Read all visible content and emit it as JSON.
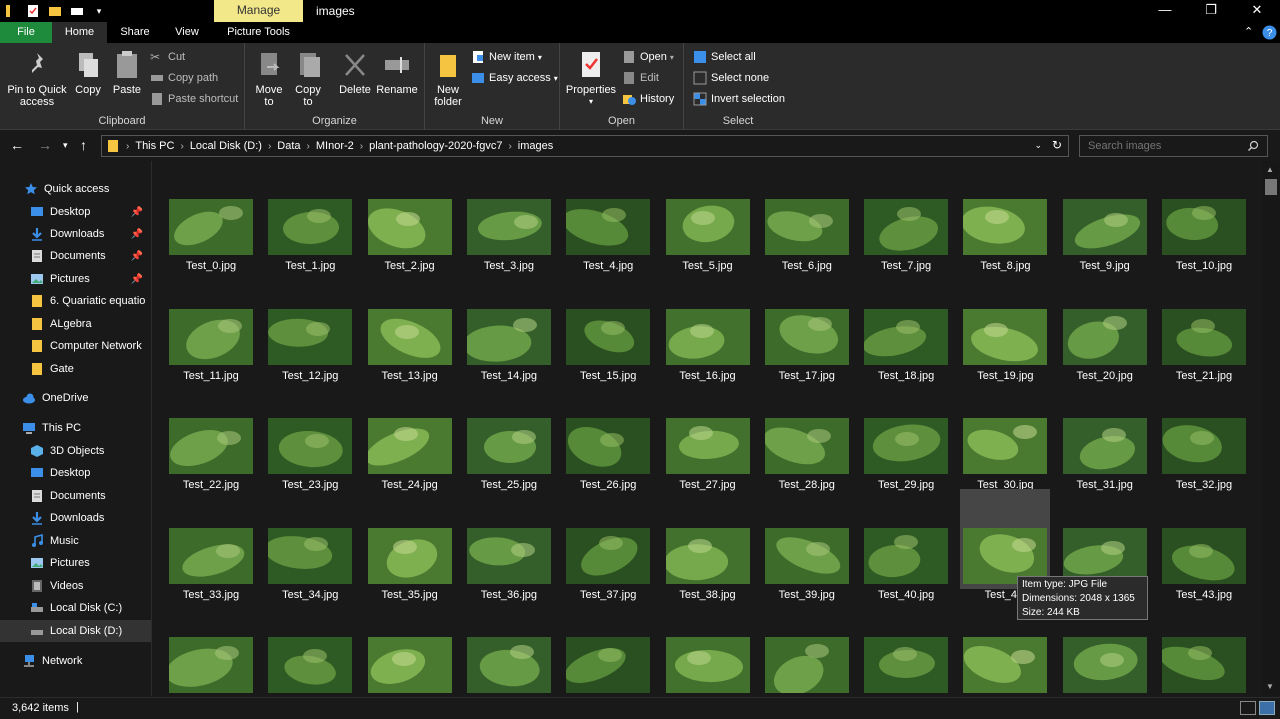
{
  "window": {
    "title": "images",
    "manage_tab": "Manage",
    "controls": {
      "minimize": "—",
      "maximize": "❐",
      "close": "✕"
    }
  },
  "ribbon_tabs": {
    "file": "File",
    "home": "Home",
    "share": "Share",
    "view": "View",
    "picture_tools": "Picture Tools"
  },
  "ribbon": {
    "clipboard": {
      "label": "Clipboard",
      "pin": "Pin to Quick access",
      "copy": "Copy",
      "paste": "Paste",
      "cut": "Cut",
      "copy_path": "Copy path",
      "paste_shortcut": "Paste shortcut"
    },
    "organize": {
      "label": "Organize",
      "move_to": "Move to",
      "copy_to": "Copy to",
      "delete": "Delete",
      "rename": "Rename"
    },
    "new": {
      "label": "New",
      "new_folder": "New folder",
      "new_item": "New item",
      "easy_access": "Easy access"
    },
    "open": {
      "label": "Open",
      "properties": "Properties",
      "open": "Open",
      "edit": "Edit",
      "history": "History"
    },
    "select": {
      "label": "Select",
      "select_all": "Select all",
      "select_none": "Select none",
      "invert": "Invert selection"
    }
  },
  "address": {
    "crumbs": [
      "This PC",
      "Local Disk (D:)",
      "Data",
      "MInor-2",
      "plant-pathology-2020-fgvc7",
      "images"
    ],
    "search_placeholder": "Search images"
  },
  "sidebar": {
    "quick_access": "Quick access",
    "qa_items": [
      "Desktop",
      "Downloads",
      "Documents",
      "Pictures",
      "6. Quariatic equatio",
      "ALgebra",
      "Computer Network",
      "Gate"
    ],
    "onedrive": "OneDrive",
    "this_pc": "This PC",
    "pc_items": [
      "3D Objects",
      "Desktop",
      "Documents",
      "Downloads",
      "Music",
      "Pictures",
      "Videos",
      "Local Disk (C:)",
      "Local Disk (D:)"
    ],
    "network": "Network"
  },
  "files": [
    "Test_0.jpg",
    "Test_1.jpg",
    "Test_2.jpg",
    "Test_3.jpg",
    "Test_4.jpg",
    "Test_5.jpg",
    "Test_6.jpg",
    "Test_7.jpg",
    "Test_8.jpg",
    "Test_9.jpg",
    "Test_10.jpg",
    "Test_11.jpg",
    "Test_12.jpg",
    "Test_13.jpg",
    "Test_14.jpg",
    "Test_15.jpg",
    "Test_16.jpg",
    "Test_17.jpg",
    "Test_18.jpg",
    "Test_19.jpg",
    "Test_20.jpg",
    "Test_21.jpg",
    "Test_22.jpg",
    "Test_23.jpg",
    "Test_24.jpg",
    "Test_25.jpg",
    "Test_26.jpg",
    "Test_27.jpg",
    "Test_28.jpg",
    "Test_29.jpg",
    "Test_30.jpg",
    "Test_31.jpg",
    "Test_32.jpg",
    "Test_33.jpg",
    "Test_34.jpg",
    "Test_35.jpg",
    "Test_36.jpg",
    "Test_37.jpg",
    "Test_38.jpg",
    "Test_39.jpg",
    "Test_40.jpg",
    "Test_41.",
    "Test_42.jpg",
    "Test_43.jpg",
    "",
    "",
    "",
    "",
    "",
    "",
    "",
    "",
    "",
    "",
    ""
  ],
  "tooltip": {
    "type": "Item type: JPG File",
    "dimensions": "Dimensions: 2048 x 1365",
    "size": "Size: 244 KB"
  },
  "status": {
    "count": "3,642 items"
  },
  "colors": {
    "file_tab": "#1e8a3c",
    "manage_tab": "#f2e88a",
    "folder": "#f5c542",
    "accent": "#3c8fe8"
  }
}
